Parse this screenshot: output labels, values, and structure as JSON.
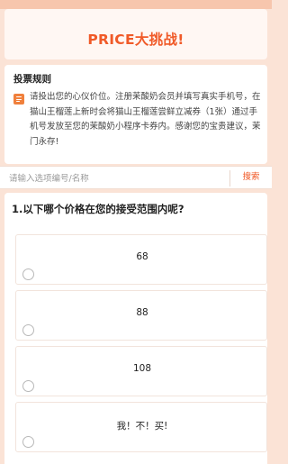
{
  "header": {
    "title": "PRICE大挑战!"
  },
  "rules": {
    "title": "投票规则",
    "body": "请投出您的心仪价位。注册茉酸奶会员并填写真实手机号，在猫山王榴莲上新时会将猫山王榴莲尝鲜立减券（1张）通过手机号发放至您的茉酸奶小程序卡券内。感谢您的宝贵建议，茉门永存!",
    "icon": "list-icon"
  },
  "search": {
    "placeholder": "请输入选项编号/名称",
    "button_label": "搜索"
  },
  "question": {
    "title": "1.以下哪个价格在您的接受范围内呢?",
    "options": [
      {
        "label": "68"
      },
      {
        "label": "88"
      },
      {
        "label": "108"
      },
      {
        "label": "我！不！买!"
      }
    ]
  },
  "colors": {
    "accent": "#f05a28",
    "background": "#fbe3d6",
    "icon": "#f0803c"
  }
}
